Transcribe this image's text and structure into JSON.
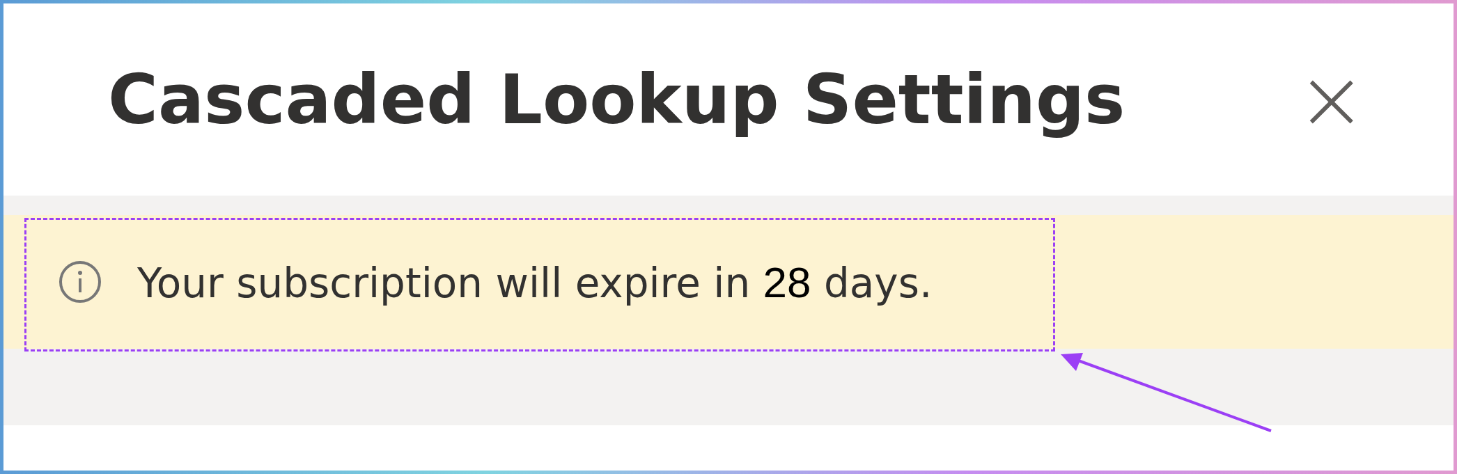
{
  "dialog": {
    "title": "Cascaded Lookup Settings",
    "close": "×"
  },
  "notice": {
    "kind": "info",
    "text_before": "Your subscription will expire in",
    "days": "28",
    "text_after": "days.",
    "highlighted": true
  }
}
